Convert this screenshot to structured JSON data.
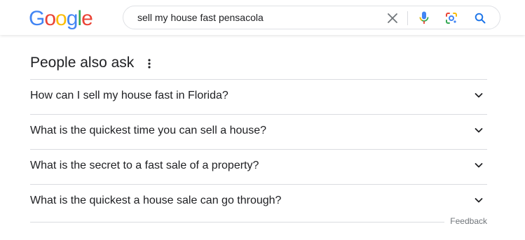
{
  "logo": {
    "letters": [
      "G",
      "o",
      "o",
      "g",
      "l",
      "e"
    ],
    "colors": [
      "#4285F4",
      "#EA4335",
      "#FBBC05",
      "#4285F4",
      "#34A853",
      "#EA4335"
    ]
  },
  "search": {
    "value": "sell my house fast pensacola",
    "icons": {
      "clear": "close-icon",
      "mic": "microphone-icon",
      "lens": "google-lens-icon",
      "search": "search-icon"
    }
  },
  "people_also_ask": {
    "title": "People also ask",
    "questions": [
      "How can I sell my house fast in Florida?",
      "What is the quickest time you can sell a house?",
      "What is the secret to a fast sale of a property?",
      "What is the quickest a house sale can go through?"
    ],
    "feedback_label": "Feedback"
  },
  "colors": {
    "text": "#202124",
    "divider": "#dadce0",
    "accent_blue": "#1a73e8",
    "muted": "#70757a"
  }
}
